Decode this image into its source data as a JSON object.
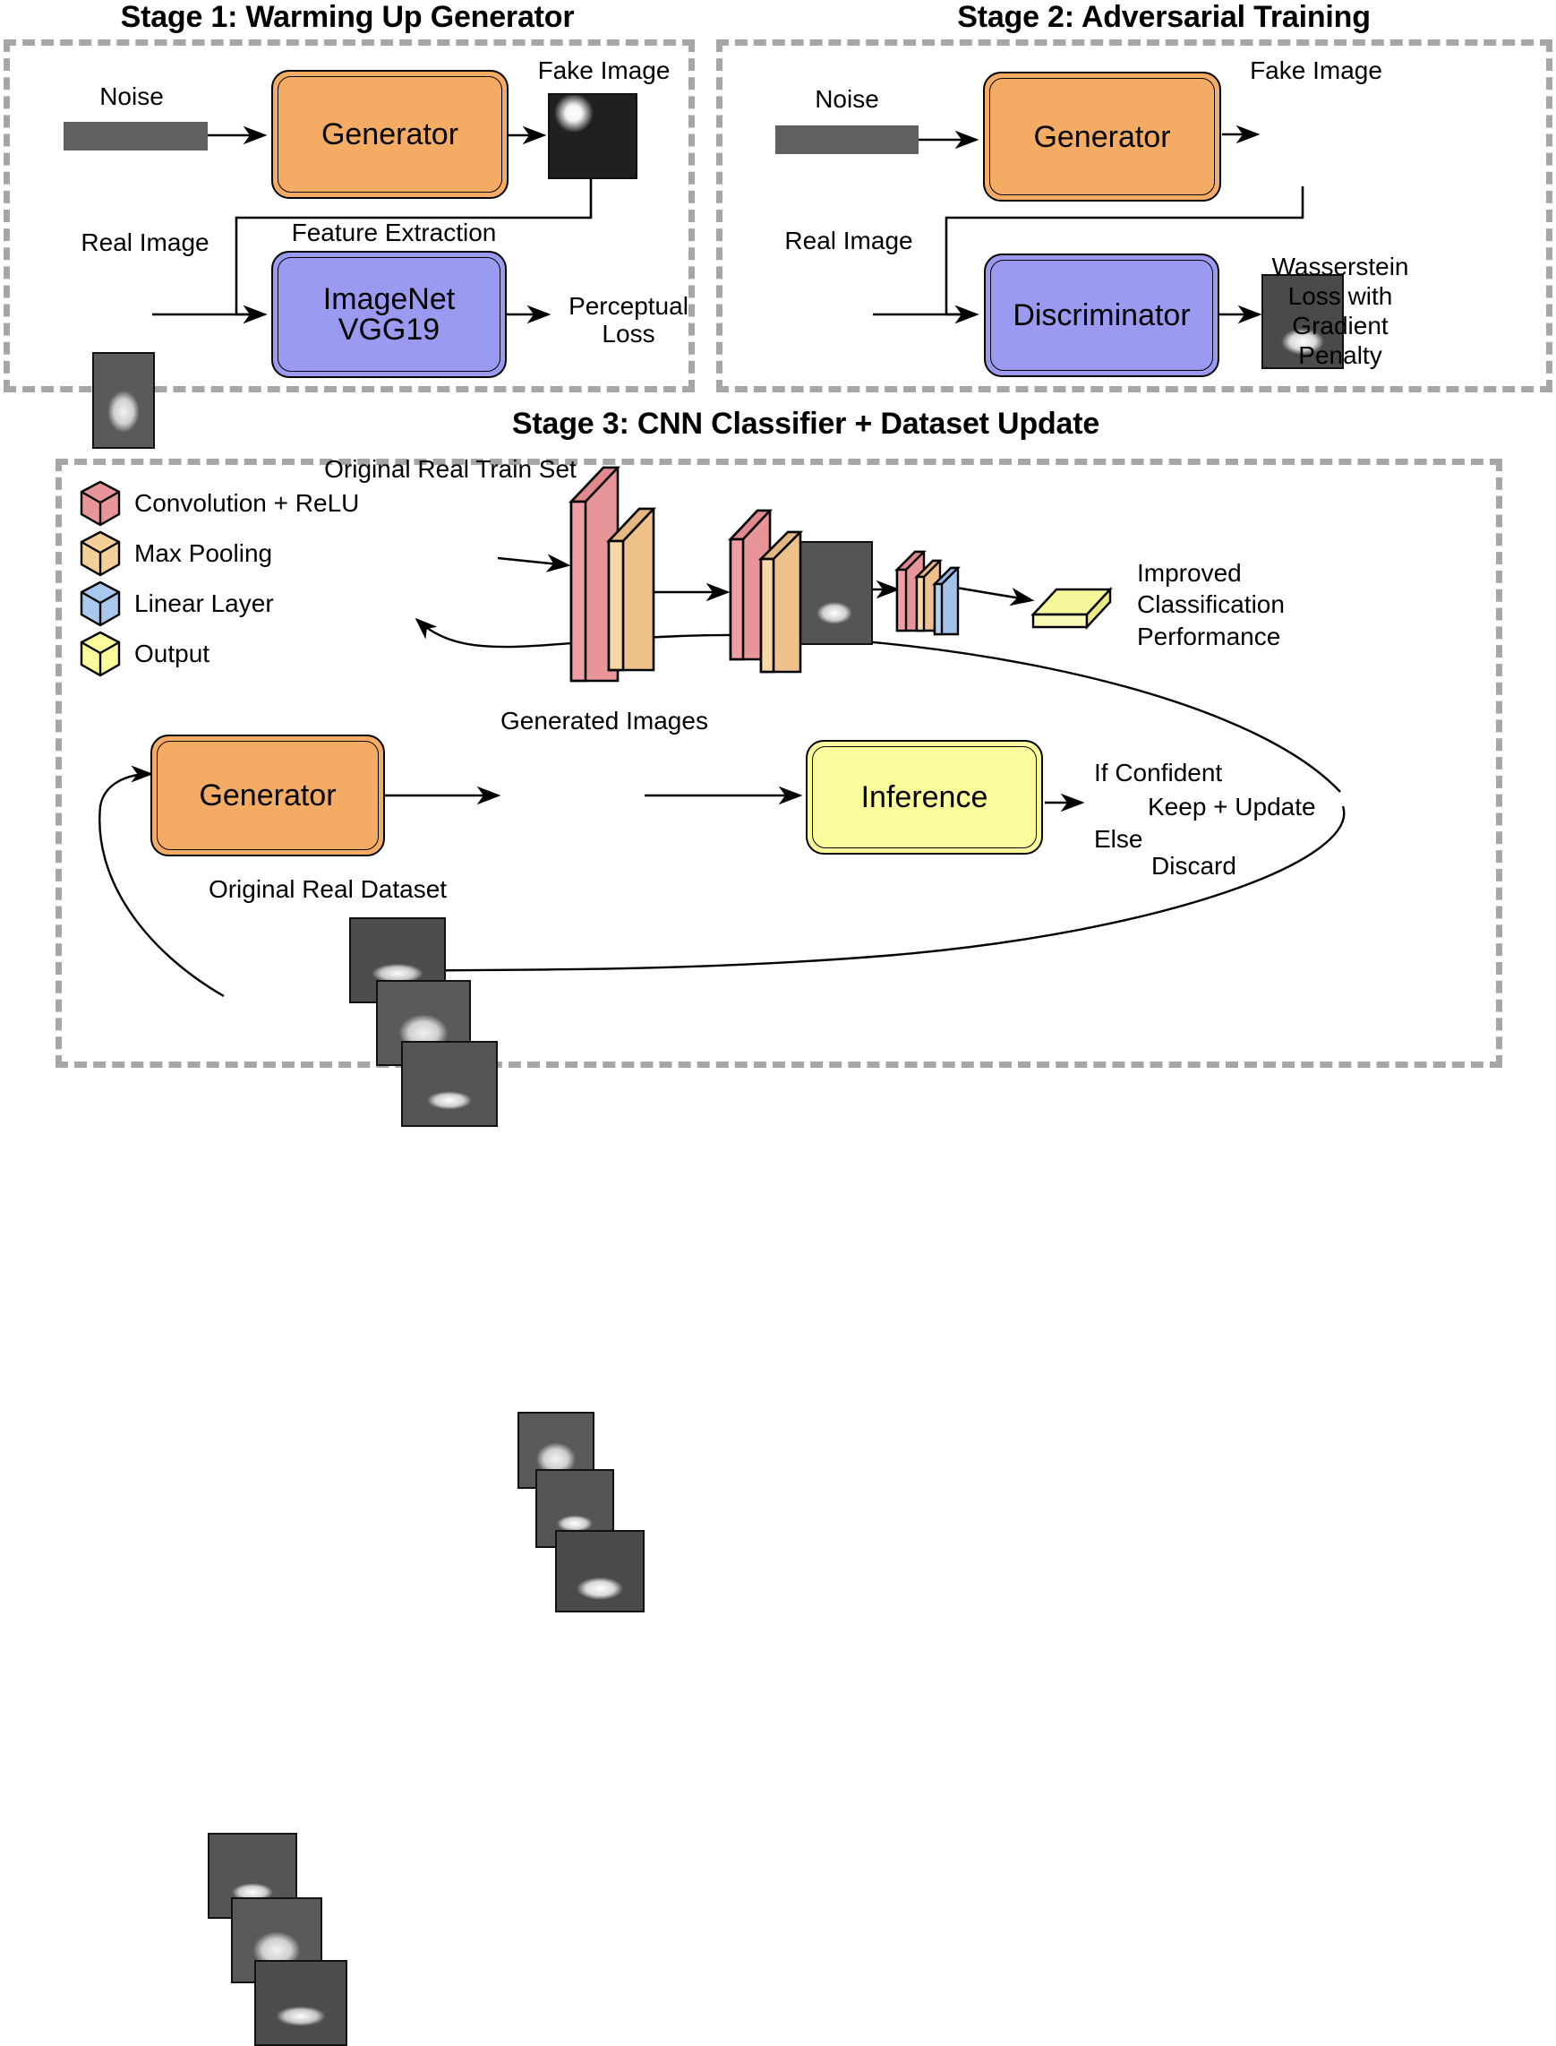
{
  "stages": [
    {
      "id": "stage1",
      "title": "Stage 1: Warming Up Generator",
      "nodes": {
        "noise_label": "Noise",
        "generator_label": "Generator",
        "fake_image_label": "Fake Image",
        "real_image_label": "Real Image",
        "feature_extraction_label": "Feature Extraction",
        "vgg_line1": "ImageNet",
        "vgg_line2": "VGG19",
        "output_line1": "Perceptual",
        "output_line2": "Loss"
      }
    },
    {
      "id": "stage2",
      "title": "Stage 2: Adversarial Training",
      "nodes": {
        "noise_label": "Noise",
        "generator_label": "Generator",
        "fake_image_label": "Fake Image",
        "real_image_label": "Real Image",
        "discriminator_label": "Discriminator",
        "output_line1": "Wasserstein",
        "output_line2": "Loss with",
        "output_line3": "Gradient",
        "output_line4": "Penalty"
      }
    },
    {
      "id": "stage3",
      "title": "Stage 3: CNN Classifier + Dataset Update",
      "nodes": {
        "train_set_label": "Original Real Train Set",
        "improved_line1": "Improved",
        "improved_line2": "Classification",
        "improved_line3": "Performance",
        "generator_label": "Generator",
        "generated_images_label": "Generated Images",
        "inference_label": "Inference",
        "if_confident": "If Confident",
        "keep_update": "Keep + Update",
        "else": "Else",
        "discard": "Discard",
        "original_real_dataset_label": "Original Real Dataset"
      }
    }
  ],
  "legend": {
    "items": [
      {
        "label": "Convolution + ReLU",
        "color": "#e8959a",
        "icon": "cube-icon"
      },
      {
        "label": "Max Pooling",
        "color": "#f5cf9a",
        "icon": "cube-icon"
      },
      {
        "label": "Linear Layer",
        "color": "#a8c8ee",
        "icon": "cube-icon"
      },
      {
        "label": "Output",
        "color": "#fbfb9b",
        "icon": "cube-icon"
      }
    ]
  },
  "colors": {
    "generator_fill": "#f4ab64",
    "vgg_fill": "#9a9af0",
    "discriminator_fill": "#9a9af0",
    "inference_fill": "#fbfb9b",
    "noise_fill": "#606060",
    "frame_dash": "#a6a6a6",
    "conv_fill": "#e8959a",
    "pool_fill": "#f5cf9a",
    "linear_fill": "#a8c8ee",
    "output_fill": "#fbfb9b",
    "stroke": "#000000"
  },
  "cnn_pipeline": {
    "blocks": [
      {
        "name": "block-1",
        "layers": [
          "conv",
          "pool"
        ]
      },
      {
        "name": "block-2",
        "layers": [
          "conv",
          "pool"
        ]
      },
      {
        "name": "block-3",
        "layers": [
          "conv",
          "pool",
          "linear"
        ]
      },
      {
        "name": "output",
        "layers": [
          "output"
        ]
      }
    ]
  }
}
